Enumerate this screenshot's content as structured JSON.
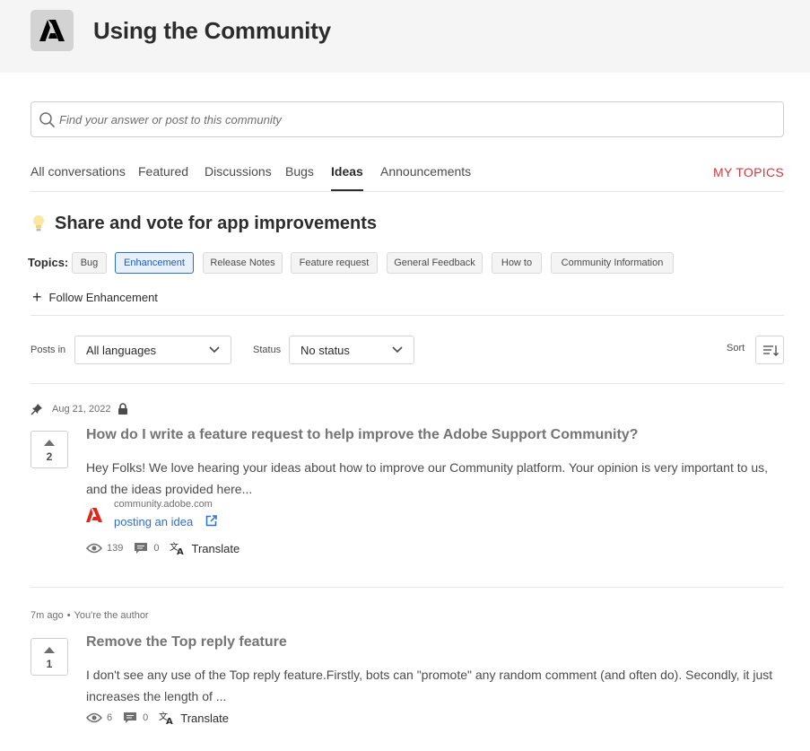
{
  "header": {
    "title": "Using the Community",
    "logo_icon": "adobe-logo"
  },
  "search": {
    "placeholder": "Find your answer or post to this community"
  },
  "tabs": [
    {
      "label": "All conversations"
    },
    {
      "label": "Featured"
    },
    {
      "label": "Discussions"
    },
    {
      "label": "Bugs"
    },
    {
      "label": "Ideas",
      "active": true
    },
    {
      "label": "Announcements"
    }
  ],
  "my_topics": "MY TOPICS",
  "section": {
    "title": "Share and vote for app improvements",
    "icon": "lightbulb-icon"
  },
  "topics": {
    "label": "Topics:",
    "chips": [
      "Bug",
      "Enhancement",
      "Release Notes",
      "Feature request",
      "General Feedback",
      "How to",
      "Community Information"
    ],
    "selected": "Enhancement"
  },
  "follow": {
    "label": "Follow Enhancement"
  },
  "filters": {
    "posts_in_label": "Posts in",
    "language_value": "All languages",
    "status_label": "Status",
    "status_value": "No status",
    "sort_label": "Sort"
  },
  "posts": [
    {
      "date": "Aug 21, 2022",
      "pinned": true,
      "locked": true,
      "votes": "2",
      "title": "How do I write a feature request to help improve the Adobe Support Community?",
      "excerpt": "Hey Folks!   We love hearing your ideas about how to improve our Community platform. Your opinion is very important to us, and the ideas provided here...",
      "link": {
        "domain": "community.adobe.com",
        "text": "posting an idea"
      },
      "views": "139",
      "replies": "0",
      "translate": "Translate"
    },
    {
      "date": "7m ago",
      "author_note": "You're the author",
      "votes": "1",
      "title": "Remove the Top reply feature",
      "excerpt": "I don't see any use of the Top reply feature.Firstly, bots can \"promote\" any random comment (and often do). Secondly, it just increases the length of ...",
      "views": "6",
      "replies": "0",
      "translate": "Translate"
    }
  ],
  "colors": {
    "accent_red": "#d7373f",
    "link_blue": "#2d6fd1",
    "chip_selected_bg": "#e8f0fb"
  }
}
